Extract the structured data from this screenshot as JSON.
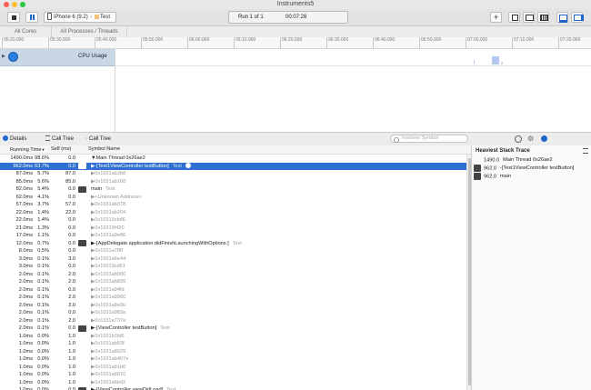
{
  "window": {
    "title": "Instruments5"
  },
  "toolbar": {
    "device": "iPhone 6 (9.2)",
    "target": "Test",
    "run": "Run 1 of 1",
    "time": "00:07:28"
  },
  "scope": {
    "all_cores": "All Cores",
    "all_processes": "All Processes / Threads"
  },
  "ruler": {
    "ticks": [
      "05:20.000",
      "05:30.000",
      "05:40.000",
      "05:50.000",
      "06:00.000",
      "06:10.000",
      "06:20.000",
      "06:30.000",
      "06:40.000",
      "06:50.000",
      "07:00.000",
      "07:10.000",
      "07:20.000"
    ]
  },
  "track": {
    "label": "CPU Usage"
  },
  "detail": {
    "details": "Details",
    "call_tree": "Call Tree",
    "call_tree_crumb": "Call Tree",
    "search_placeholder": "Involves Symbol"
  },
  "columns": {
    "running_time": "Running Time",
    "self": "Self (ms)",
    "symbol": "Symbol Name"
  },
  "rows": [
    {
      "t": "1490.0ms",
      "p": "98.6%",
      "s": "0.0",
      "sym": "▼Main Thread  0x26ae2",
      "lib": "",
      "dim": false,
      "person": false
    },
    {
      "t": "962.0ms",
      "p": "63.7%",
      "s": "0.0",
      "sym": "▶-[Test1ViewController testButton]",
      "lib": "Test",
      "dim": false,
      "person": true,
      "sel": true
    },
    {
      "t": "87.0ms",
      "p": "5.7%",
      "s": "87.0",
      "sym": "▶0x1031ab2b8",
      "lib": "",
      "dim": true,
      "person": false
    },
    {
      "t": "85.0ms",
      "p": "5.6%",
      "s": "85.0",
      "sym": "▶0x1031ab168",
      "lib": "",
      "dim": true,
      "person": false
    },
    {
      "t": "82.0ms",
      "p": "5.4%",
      "s": "0.0",
      "sym": "main",
      "lib": "Test",
      "dim": false,
      "person": true
    },
    {
      "t": "62.0ms",
      "p": "4.1%",
      "s": "0.0",
      "sym": "▶<Unknown Address>",
      "lib": "",
      "dim": true,
      "person": false
    },
    {
      "t": "57.0ms",
      "p": "3.7%",
      "s": "57.0",
      "sym": "▶0x1031ab378",
      "lib": "",
      "dim": true,
      "person": false
    },
    {
      "t": "22.0ms",
      "p": "1.4%",
      "s": "22.0",
      "sym": "▶0x1031ab204",
      "lib": "",
      "dim": true,
      "person": false
    },
    {
      "t": "22.0ms",
      "p": "1.4%",
      "s": "0.0",
      "sym": "▶0x10319cbd6",
      "lib": "",
      "dim": true,
      "person": false
    },
    {
      "t": "21.0ms",
      "p": "1.3%",
      "s": "0.0",
      "sym": "▶0x10319f420",
      "lib": "",
      "dim": true,
      "person": false
    },
    {
      "t": "17.0ms",
      "p": "1.1%",
      "s": "0.0",
      "sym": "▶0x1031a9e86",
      "lib": "",
      "dim": true,
      "person": false
    },
    {
      "t": "12.0ms",
      "p": "0.7%",
      "s": "0.0",
      "sym": "▶-[AppDelegate application:didFinishLaunchingWithOptions:]",
      "lib": "Test",
      "dim": false,
      "person": true
    },
    {
      "t": "8.0ms",
      "p": "0.5%",
      "s": "0.0",
      "sym": "▶0x1031a7f8f",
      "lib": "",
      "dim": true,
      "person": false
    },
    {
      "t": "3.0ms",
      "p": "0.1%",
      "s": "3.0",
      "sym": "▶0x1031a8e44",
      "lib": "",
      "dim": true,
      "person": false
    },
    {
      "t": "3.0ms",
      "p": "0.1%",
      "s": "0.0",
      "sym": "▶0x10319cd61",
      "lib": "",
      "dim": true,
      "person": false
    },
    {
      "t": "2.0ms",
      "p": "0.1%",
      "s": "2.0",
      "sym": "▶0x1031ab000",
      "lib": "",
      "dim": true,
      "person": false
    },
    {
      "t": "2.0ms",
      "p": "0.1%",
      "s": "2.0",
      "sym": "▶0x1031ab839",
      "lib": "",
      "dim": true,
      "person": false
    },
    {
      "t": "2.0ms",
      "p": "0.1%",
      "s": "0.0",
      "sym": "▶0x1031a94fd",
      "lib": "",
      "dim": true,
      "person": false
    },
    {
      "t": "2.0ms",
      "p": "0.1%",
      "s": "2.0",
      "sym": "▶0x1031a9060",
      "lib": "",
      "dim": true,
      "person": false
    },
    {
      "t": "2.0ms",
      "p": "0.1%",
      "s": "2.0",
      "sym": "▶0x1031a8e5b",
      "lib": "",
      "dim": true,
      "person": false
    },
    {
      "t": "2.0ms",
      "p": "0.1%",
      "s": "0.0",
      "sym": "▶0x1031a983a",
      "lib": "",
      "dim": true,
      "person": false
    },
    {
      "t": "2.0ms",
      "p": "0.1%",
      "s": "2.0",
      "sym": "▶0x1031a737e",
      "lib": "",
      "dim": true,
      "person": false
    },
    {
      "t": "2.0ms",
      "p": "0.1%",
      "s": "0.0",
      "sym": "▶-[ViewController testButton]",
      "lib": "Test",
      "dim": false,
      "person": true
    },
    {
      "t": "1.0ms",
      "p": "0.0%",
      "s": "1.0",
      "sym": "▶0x1031b1fd6",
      "lib": "",
      "dim": true,
      "person": false
    },
    {
      "t": "1.0ms",
      "p": "0.0%",
      "s": "1.0",
      "sym": "▶0x1031ab83f",
      "lib": "",
      "dim": true,
      "person": false
    },
    {
      "t": "1.0ms",
      "p": "0.0%",
      "s": "1.0",
      "sym": "▶0x1031a8029",
      "lib": "",
      "dim": true,
      "person": false
    },
    {
      "t": "1.0ms",
      "p": "0.0%",
      "s": "1.0",
      "sym": "▶0x1031ab407e",
      "lib": "",
      "dim": true,
      "person": false
    },
    {
      "t": "1.0ms",
      "p": "0.0%",
      "s": "1.0",
      "sym": "▶0x1031ab1b6",
      "lib": "",
      "dim": true,
      "person": false
    },
    {
      "t": "1.0ms",
      "p": "0.0%",
      "s": "1.0",
      "sym": "▶0x1031ab810",
      "lib": "",
      "dim": true,
      "person": false
    },
    {
      "t": "1.0ms",
      "p": "0.0%",
      "s": "1.0",
      "sym": "▶0x1031a8ed2",
      "lib": "",
      "dim": true,
      "person": false
    },
    {
      "t": "1.0ms",
      "p": "0.0%",
      "s": "0.0",
      "sym": "▶-[ViewController viewDidLoad]",
      "lib": "Test",
      "dim": false,
      "person": true
    }
  ],
  "heaviest": {
    "title": "Heaviest Stack Trace",
    "items": [
      {
        "v": "1490.0",
        "name": "Main Thread  0x26ae2",
        "person": false
      },
      {
        "v": "962.0",
        "name": "-[Test1ViewController testButton]",
        "person": true
      },
      {
        "v": "962.0",
        "name": "main",
        "person": true
      }
    ]
  }
}
